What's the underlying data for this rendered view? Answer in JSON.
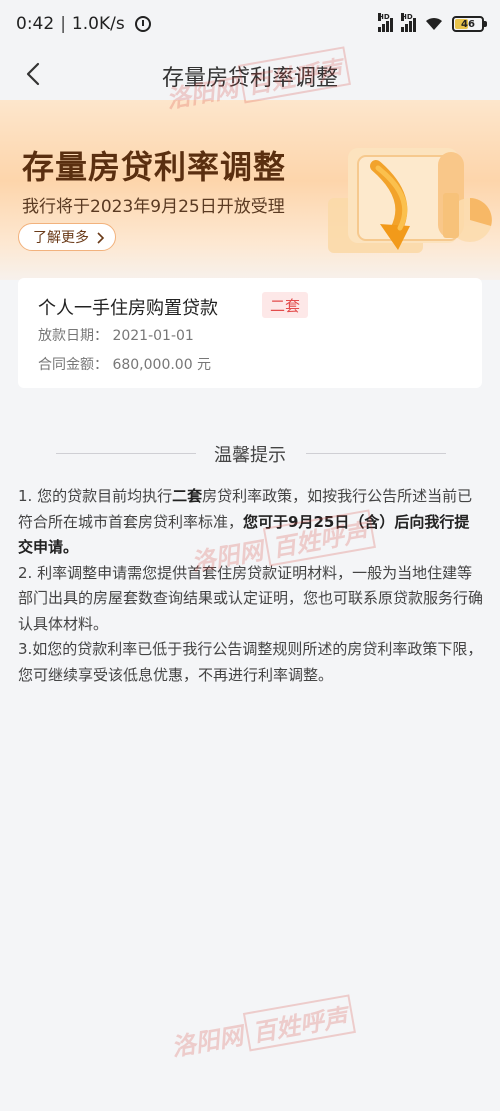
{
  "status_bar": {
    "time": "0:42",
    "net_speed": "1.0K/s",
    "signal_label": "HD",
    "battery": "46"
  },
  "nav": {
    "title": "存量房贷利率调整"
  },
  "banner": {
    "title": "存量房贷利率调整",
    "subtitle": "我行将于2023年9月25日开放受理",
    "learn_more": "了解更多"
  },
  "loan": {
    "title": "个人一手住房购置贷款",
    "badge": "二套",
    "date_label": "放款日期：",
    "date_value": "2021-01-01",
    "amount_label": "合同金额：",
    "amount_value": "680,000.00 元"
  },
  "tips": {
    "title": "温馨提示",
    "p1_a": "1. 您的贷款目前均执行",
    "p1_b": "二套",
    "p1_c": "房贷利率政策，如按我行公告所述当前已符合所在城市首套房贷利率标准，",
    "p1_d": "您可于9月25日（含）后向我行提交申请。",
    "p2": "2. 利率调整申请需您提供首套住房贷款证明材料，一般为当地住建等部门出具的房屋套数查询结果或认定证明，您也可联系原贷款服务行确认具体材料。",
    "p3": "3.如您的贷款利率已低于我行公告调整规则所述的房贷利率政策下限，您可继续享受该低息优惠，不再进行利率调整。"
  },
  "watermark": {
    "site": "洛阳网",
    "tag": "百姓呼声"
  },
  "colors": {
    "badge_text": "#e34c4c",
    "badge_bg": "#fde8e8",
    "banner_title": "#5a2f10",
    "page_bg": "#f4f5f7"
  }
}
